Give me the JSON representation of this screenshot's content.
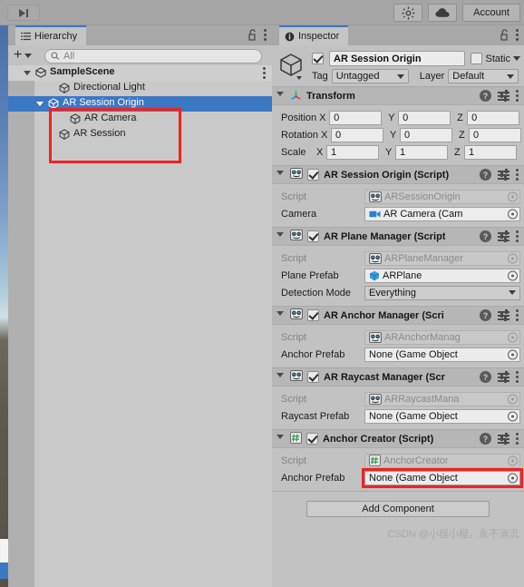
{
  "toolbar": {
    "step_icon": "step-forward-icon",
    "gizmo_icon": "gizmo-light-icon",
    "cloud_icon": "cloud-icon",
    "account_label": "Account"
  },
  "hierarchy": {
    "tab_label": "Hierarchy",
    "tab_icon": "hierarchy-list-icon",
    "lock_icon": "lock-open-icon",
    "menu_icon": "kebab-menu-icon",
    "create_label": "+",
    "search": {
      "placeholder": "All",
      "value": "",
      "icon": "search-icon"
    },
    "rows": [
      {
        "label": "SampleScene",
        "indent": 30,
        "type": "scene",
        "icon": "scene-icon",
        "expanded": true,
        "selected": false,
        "has_menu": true
      },
      {
        "label": "Directional Light",
        "indent": 56,
        "type": "gameobject",
        "icon": "gameobject-icon",
        "expanded": false,
        "selected": false,
        "has_menu": false
      },
      {
        "label": "AR Session Origin",
        "indent": 44,
        "type": "gameobject",
        "icon": "gameobject-icon",
        "expanded": true,
        "selected": true,
        "has_menu": false
      },
      {
        "label": "AR Camera",
        "indent": 68,
        "type": "gameobject",
        "icon": "gameobject-icon",
        "expanded": false,
        "selected": false,
        "has_menu": false
      },
      {
        "label": "AR Session",
        "indent": 56,
        "type": "gameobject",
        "icon": "gameobject-icon",
        "expanded": false,
        "selected": false,
        "has_menu": false
      }
    ]
  },
  "inspector": {
    "tab_label": "Inspector",
    "tab_icon": "info-icon",
    "lock_icon": "lock-open-icon",
    "menu_icon": "kebab-menu-icon",
    "object": {
      "icon": "gameobject-cube-icon",
      "enabled": true,
      "name": "AR Session Origin",
      "static_label": "Static",
      "static_checked": false,
      "tag_label": "Tag",
      "tag_value": "Untagged",
      "layer_label": "Layer",
      "layer_value": "Default"
    },
    "components": [
      {
        "title": "Transform",
        "icon": "transform-axis-icon",
        "has_enable_toggle": false,
        "enabled": true,
        "expanded": true,
        "kind": "vectors",
        "vectors": [
          {
            "label": "Position",
            "x": "0",
            "y": "0",
            "z": "0"
          },
          {
            "label": "Rotation",
            "x": "0",
            "y": "0",
            "z": "0"
          },
          {
            "label": "Scale",
            "x": "1",
            "y": "1",
            "z": "1"
          }
        ]
      },
      {
        "title": "AR Session Origin (Script)",
        "icon": "cs-script-icon",
        "has_enable_toggle": true,
        "enabled": true,
        "expanded": true,
        "kind": "props",
        "props": [
          {
            "label": "Script",
            "value": "ARSessionOrigin",
            "dim": true,
            "icon": "cs-script-icon",
            "objectfield": true
          },
          {
            "label": "Camera",
            "value": "AR Camera (Cam",
            "dim": false,
            "icon": "camera-icon",
            "objectfield": true
          }
        ]
      },
      {
        "title": "AR Plane Manager (Script",
        "icon": "cs-script-icon",
        "has_enable_toggle": true,
        "enabled": true,
        "expanded": true,
        "kind": "props",
        "props": [
          {
            "label": "Script",
            "value": "ARPlaneManager",
            "dim": true,
            "icon": "cs-script-icon",
            "objectfield": true
          },
          {
            "label": "Plane Prefab",
            "value": "ARPlane",
            "dim": false,
            "icon": "prefab-icon",
            "objectfield": true
          },
          {
            "label": "Detection Mode",
            "value": "Everything",
            "dim": false,
            "icon": "",
            "objectfield": false,
            "dropdown": true
          }
        ]
      },
      {
        "title": "AR Anchor Manager (Scri",
        "icon": "cs-script-icon",
        "has_enable_toggle": true,
        "enabled": true,
        "expanded": true,
        "kind": "props",
        "props": [
          {
            "label": "Script",
            "value": "ARAnchorManag",
            "dim": true,
            "icon": "cs-script-icon",
            "objectfield": true
          },
          {
            "label": "Anchor Prefab",
            "value": "None (Game Object",
            "dim": false,
            "icon": "",
            "objectfield": true
          }
        ]
      },
      {
        "title": "AR Raycast Manager (Scr",
        "icon": "cs-script-icon",
        "has_enable_toggle": true,
        "enabled": true,
        "expanded": true,
        "kind": "props",
        "props": [
          {
            "label": "Script",
            "value": "ARRaycastMana",
            "dim": true,
            "icon": "cs-script-icon",
            "objectfield": true
          },
          {
            "label": "Raycast Prefab",
            "value": "None (Game Object",
            "dim": false,
            "icon": "",
            "objectfield": true
          }
        ]
      },
      {
        "title": "Anchor Creator (Script)",
        "icon": "cs-hash-icon",
        "has_enable_toggle": true,
        "enabled": true,
        "expanded": true,
        "kind": "props",
        "props": [
          {
            "label": "Script",
            "value": "AnchorCreator",
            "dim": true,
            "icon": "cs-hash-icon",
            "objectfield": true
          },
          {
            "label": "Anchor Prefab",
            "value": "None (Game Object",
            "dim": false,
            "icon": "",
            "objectfield": true,
            "highlighted": true
          }
        ]
      }
    ],
    "add_component_label": "Add Component",
    "watermark": "CSDN @小程小程，永不消沉"
  },
  "annotations": {
    "hierarchy_box_color": "#f02222",
    "anchor_prefab_box_color": "#f02222"
  },
  "colors": {
    "selection_blue": "#3b78c4",
    "panel_bg": "#c2c2c2",
    "header_bg": "#b6b6b6",
    "toolbar_bg": "#a5a5a5"
  }
}
